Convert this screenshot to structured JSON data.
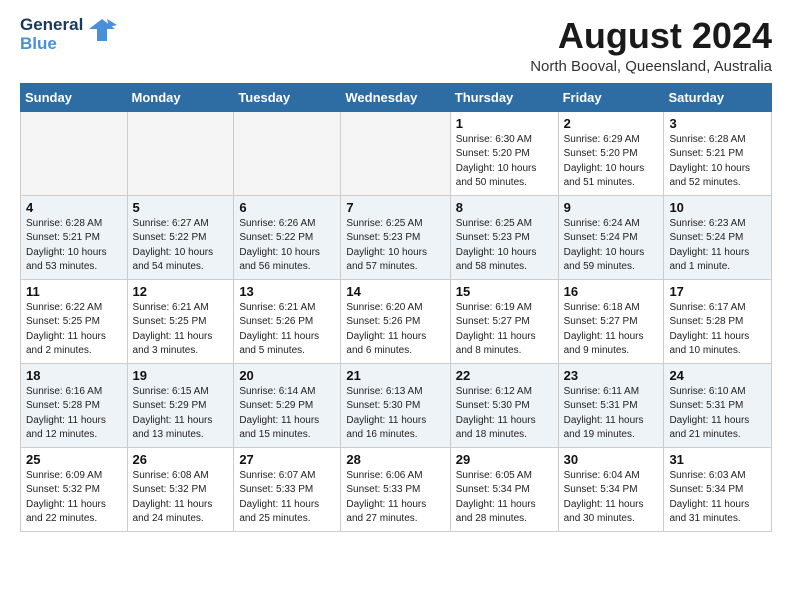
{
  "header": {
    "logo_line1": "General",
    "logo_line2": "Blue",
    "main_title": "August 2024",
    "subtitle": "North Booval, Queensland, Australia"
  },
  "days_of_week": [
    "Sunday",
    "Monday",
    "Tuesday",
    "Wednesday",
    "Thursday",
    "Friday",
    "Saturday"
  ],
  "weeks": [
    [
      {
        "day": "",
        "info": ""
      },
      {
        "day": "",
        "info": ""
      },
      {
        "day": "",
        "info": ""
      },
      {
        "day": "",
        "info": ""
      },
      {
        "day": "1",
        "info": "Sunrise: 6:30 AM\nSunset: 5:20 PM\nDaylight: 10 hours\nand 50 minutes."
      },
      {
        "day": "2",
        "info": "Sunrise: 6:29 AM\nSunset: 5:20 PM\nDaylight: 10 hours\nand 51 minutes."
      },
      {
        "day": "3",
        "info": "Sunrise: 6:28 AM\nSunset: 5:21 PM\nDaylight: 10 hours\nand 52 minutes."
      }
    ],
    [
      {
        "day": "4",
        "info": "Sunrise: 6:28 AM\nSunset: 5:21 PM\nDaylight: 10 hours\nand 53 minutes."
      },
      {
        "day": "5",
        "info": "Sunrise: 6:27 AM\nSunset: 5:22 PM\nDaylight: 10 hours\nand 54 minutes."
      },
      {
        "day": "6",
        "info": "Sunrise: 6:26 AM\nSunset: 5:22 PM\nDaylight: 10 hours\nand 56 minutes."
      },
      {
        "day": "7",
        "info": "Sunrise: 6:25 AM\nSunset: 5:23 PM\nDaylight: 10 hours\nand 57 minutes."
      },
      {
        "day": "8",
        "info": "Sunrise: 6:25 AM\nSunset: 5:23 PM\nDaylight: 10 hours\nand 58 minutes."
      },
      {
        "day": "9",
        "info": "Sunrise: 6:24 AM\nSunset: 5:24 PM\nDaylight: 10 hours\nand 59 minutes."
      },
      {
        "day": "10",
        "info": "Sunrise: 6:23 AM\nSunset: 5:24 PM\nDaylight: 11 hours\nand 1 minute."
      }
    ],
    [
      {
        "day": "11",
        "info": "Sunrise: 6:22 AM\nSunset: 5:25 PM\nDaylight: 11 hours\nand 2 minutes."
      },
      {
        "day": "12",
        "info": "Sunrise: 6:21 AM\nSunset: 5:25 PM\nDaylight: 11 hours\nand 3 minutes."
      },
      {
        "day": "13",
        "info": "Sunrise: 6:21 AM\nSunset: 5:26 PM\nDaylight: 11 hours\nand 5 minutes."
      },
      {
        "day": "14",
        "info": "Sunrise: 6:20 AM\nSunset: 5:26 PM\nDaylight: 11 hours\nand 6 minutes."
      },
      {
        "day": "15",
        "info": "Sunrise: 6:19 AM\nSunset: 5:27 PM\nDaylight: 11 hours\nand 8 minutes."
      },
      {
        "day": "16",
        "info": "Sunrise: 6:18 AM\nSunset: 5:27 PM\nDaylight: 11 hours\nand 9 minutes."
      },
      {
        "day": "17",
        "info": "Sunrise: 6:17 AM\nSunset: 5:28 PM\nDaylight: 11 hours\nand 10 minutes."
      }
    ],
    [
      {
        "day": "18",
        "info": "Sunrise: 6:16 AM\nSunset: 5:28 PM\nDaylight: 11 hours\nand 12 minutes."
      },
      {
        "day": "19",
        "info": "Sunrise: 6:15 AM\nSunset: 5:29 PM\nDaylight: 11 hours\nand 13 minutes."
      },
      {
        "day": "20",
        "info": "Sunrise: 6:14 AM\nSunset: 5:29 PM\nDaylight: 11 hours\nand 15 minutes."
      },
      {
        "day": "21",
        "info": "Sunrise: 6:13 AM\nSunset: 5:30 PM\nDaylight: 11 hours\nand 16 minutes."
      },
      {
        "day": "22",
        "info": "Sunrise: 6:12 AM\nSunset: 5:30 PM\nDaylight: 11 hours\nand 18 minutes."
      },
      {
        "day": "23",
        "info": "Sunrise: 6:11 AM\nSunset: 5:31 PM\nDaylight: 11 hours\nand 19 minutes."
      },
      {
        "day": "24",
        "info": "Sunrise: 6:10 AM\nSunset: 5:31 PM\nDaylight: 11 hours\nand 21 minutes."
      }
    ],
    [
      {
        "day": "25",
        "info": "Sunrise: 6:09 AM\nSunset: 5:32 PM\nDaylight: 11 hours\nand 22 minutes."
      },
      {
        "day": "26",
        "info": "Sunrise: 6:08 AM\nSunset: 5:32 PM\nDaylight: 11 hours\nand 24 minutes."
      },
      {
        "day": "27",
        "info": "Sunrise: 6:07 AM\nSunset: 5:33 PM\nDaylight: 11 hours\nand 25 minutes."
      },
      {
        "day": "28",
        "info": "Sunrise: 6:06 AM\nSunset: 5:33 PM\nDaylight: 11 hours\nand 27 minutes."
      },
      {
        "day": "29",
        "info": "Sunrise: 6:05 AM\nSunset: 5:34 PM\nDaylight: 11 hours\nand 28 minutes."
      },
      {
        "day": "30",
        "info": "Sunrise: 6:04 AM\nSunset: 5:34 PM\nDaylight: 11 hours\nand 30 minutes."
      },
      {
        "day": "31",
        "info": "Sunrise: 6:03 AM\nSunset: 5:34 PM\nDaylight: 11 hours\nand 31 minutes."
      }
    ]
  ]
}
